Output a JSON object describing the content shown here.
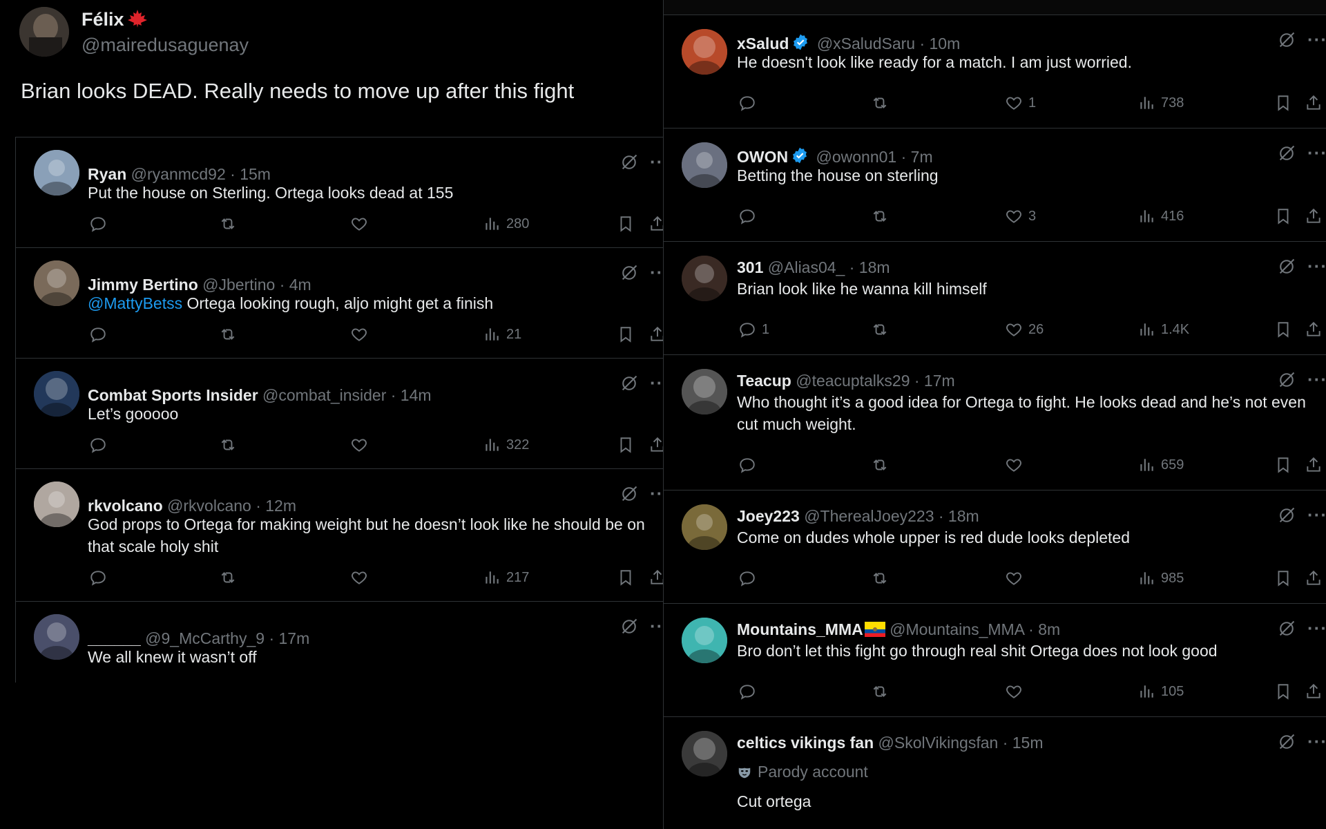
{
  "main_tweet": {
    "name": "Félix",
    "handle": "@mairedusaguenay",
    "text": "Brian looks DEAD. Really needs to move up after this fight"
  },
  "left_replies": [
    {
      "name": "Ryan",
      "meta": "@ryanmcd92 · 15m",
      "text": "Put the house on Sterling. Ortega looks dead at 155",
      "views": "280",
      "avatar_color": "#8aa0b8"
    },
    {
      "name": "Jimmy Bertino",
      "meta": "@Jbertino · 4m",
      "mention": "@MattyBetss",
      "text": " Ortega looking rough, aljo might get a finish",
      "views": "21",
      "avatar_color": "#7a6a5a"
    },
    {
      "name": "Combat Sports Insider",
      "meta": "@combat_insider · 14m",
      "text": "Let’s gooooo",
      "views": "322",
      "avatar_color": "#22385a"
    },
    {
      "name": "rkvolcano",
      "meta": "@rkvolcano · 12m",
      "text": "God props to Ortega for making weight but he doesn’t look like he should be on that scale holy shit",
      "views": "217",
      "avatar_color": "#b0a7a0"
    },
    {
      "name": "______",
      "meta": "@9_McCarthy_9 · 17m",
      "text": "We all knew it wasn’t off",
      "views": "",
      "avatar_color": "#4a4f6a"
    }
  ],
  "right_replies": [
    {
      "name": "xSalud",
      "verified": true,
      "meta": "@xSaludSaru · 10m",
      "text": "He doesn't look like ready for a match. I am just worried.",
      "replies": "",
      "likes": "1",
      "views": "738",
      "avatar_color": "#b84a2a"
    },
    {
      "name": "OWON",
      "verified": true,
      "meta": "@owonn01 · 7m",
      "text": "Betting the house on sterling",
      "replies": "",
      "likes": "3",
      "views": "416",
      "avatar_color": "#6a7080"
    },
    {
      "name": "301",
      "verified": false,
      "meta": "@Alias04_ · 18m",
      "text": "Brian look like he wanna kill himself",
      "replies": "1",
      "likes": "26",
      "views": "1.4K",
      "avatar_color": "#3a2a24"
    },
    {
      "name": "Teacup",
      "verified": false,
      "meta": "@teacuptalks29 · 17m",
      "text": "Who thought it’s a good idea for Ortega to fight. He looks dead and he’s not even cut much weight.",
      "replies": "",
      "likes": "",
      "views": "659",
      "avatar_color": "#555555"
    },
    {
      "name": "Joey223",
      "verified": false,
      "meta": "@TherealJoey223 · 18m",
      "text": "Come on dudes whole upper is red dude looks depleted",
      "replies": "",
      "likes": "",
      "views": "985",
      "avatar_color": "#7a6a3a"
    },
    {
      "name": "Mountains_MMA",
      "verified": false,
      "flag": true,
      "meta": "@Mountains_MMA · 8m",
      "text": "Bro don’t let this fight go through real shit Ortega does not look good",
      "replies": "",
      "likes": "",
      "views": "105",
      "avatar_color": "#3fb5b0"
    },
    {
      "name": "celtics vikings fan",
      "verified": false,
      "meta": "@SkolVikingsfan · 15m",
      "badge": "Parody account",
      "text": "Cut ortega",
      "replies": "",
      "likes": "",
      "views": "",
      "avatar_color": "#3a3a3a"
    }
  ],
  "icons": [
    "reply-icon",
    "retweet-icon",
    "like-icon",
    "views-icon",
    "bookmark-icon",
    "share-icon",
    "grok-icon",
    "more-icon",
    "verified-icon",
    "flag-icon",
    "mask-icon"
  ],
  "colors": {
    "background": "#000000",
    "text": "#e7e9ea",
    "muted": "#71767b",
    "link": "#1d9bf0",
    "border": "#2f3336"
  }
}
